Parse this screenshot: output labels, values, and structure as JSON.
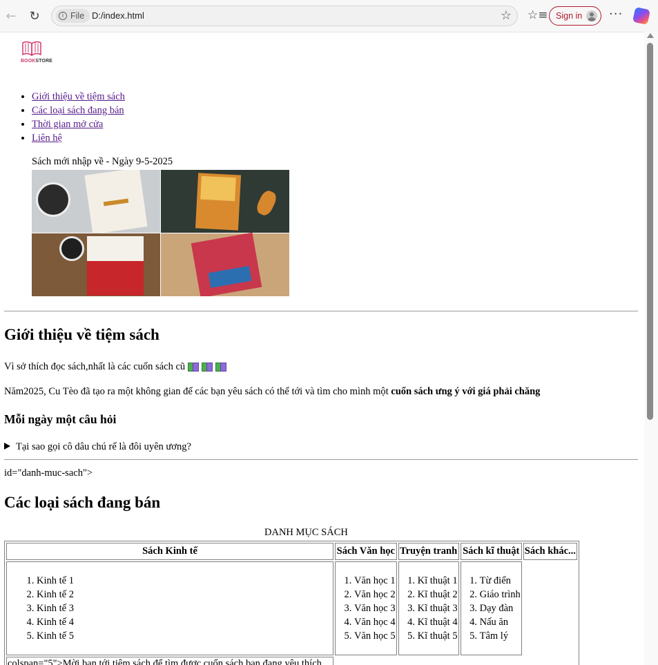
{
  "browser": {
    "file_label": "File",
    "url": "D:/index.html",
    "signin_label": "Sign in",
    "more_label": "···"
  },
  "logo": {
    "brand_prefix": "BOOK",
    "brand_suffix": "STORE"
  },
  "menu": [
    "Giới thiệu về tiệm sách",
    "Các loại sách đang bán",
    "Thời gian mở cửa",
    "Liên hệ"
  ],
  "new_arrivals": {
    "caption": "Sách mới nhập về - Ngày 9-5-2025"
  },
  "intro": {
    "heading": "Giới thiệu về tiệm sách",
    "line1": "Vì sở thích đọc sách,nhất là các cuốn sách cũ",
    "line2_prefix": "Năm2025, Cu Tèo đã tạo ra một không gian để các bạn yêu sách có thể tới và tìm cho mình một",
    "line2_bold": "cuốn sách ưng ý với giá phải chăng"
  },
  "daily_question": {
    "heading": "Mỗi ngày một câu hỏi",
    "summary": "Tại sao gọi cô dâu chú rể là đôi uyên ương?"
  },
  "stray_text": "id=\"danh-muc-sach\">",
  "catalog": {
    "heading": "Các loại sách đang bán",
    "caption": "DANH MỤC SÁCH",
    "columns": [
      {
        "header": "Sách Kinh tế",
        "items": [
          "Kinh tế 1",
          "Kinh tế 2",
          "Kinh tế 3",
          "Kinh tế 4",
          "Kinh tế 5"
        ]
      },
      {
        "header": "Sách Văn học",
        "items": [
          "Văn học 1",
          "Văn học 2",
          "Văn học 3",
          "Văn học 4",
          "Văn học 5"
        ]
      },
      {
        "header": "Truyện tranh",
        "items": [
          "Kĩ thuật 1",
          "Kĩ thuật 2",
          "Kĩ thuật 3",
          "Kĩ thuật 4",
          "Kĩ thuật 5"
        ]
      },
      {
        "header": "Sách kĩ thuật",
        "items": [
          "Từ điển",
          "Giáo trình",
          "Dạy đàn",
          "Nấu ăn",
          "Tâm lý"
        ]
      },
      {
        "header": "Sách khác...",
        "items": []
      }
    ],
    "footer_text": "colspan=\"5\">Mời bạn tới tiệm sách để tìm được cuốn sách bạn đang yêu thích"
  }
}
